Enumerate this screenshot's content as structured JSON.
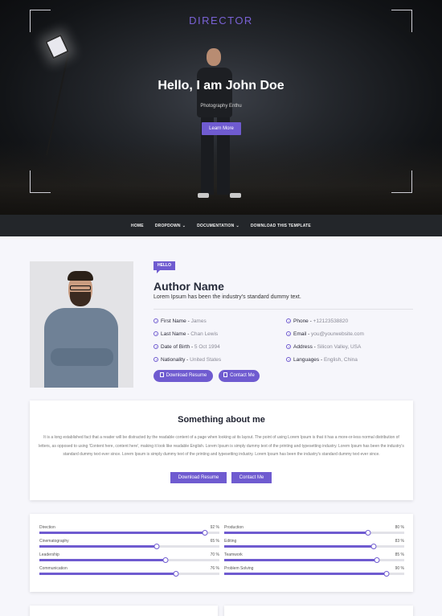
{
  "hero": {
    "brand": "DIRECTOR",
    "title": "Hello, I am John Doe",
    "subtitle": "Photography Enthu",
    "button": "Learn More"
  },
  "nav": {
    "items": [
      {
        "label": "HOME",
        "dropdown": false
      },
      {
        "label": "DROPDOWN",
        "dropdown": true
      },
      {
        "label": "DOCUMENTATION",
        "dropdown": true
      },
      {
        "label": "DOWNLOAD THIS TEMPLATE",
        "dropdown": false
      }
    ]
  },
  "profile": {
    "badge": "HELLO",
    "name": "Author Name",
    "tagline": "Lorem Ipsum has been the industry's standard dummy text.",
    "left_info": [
      {
        "label": "First Name",
        "value": "James"
      },
      {
        "label": "Last Name",
        "value": "Chan Lewis"
      },
      {
        "label": "Date of Birth",
        "value": "5 Oct 1994"
      },
      {
        "label": "Nationality",
        "value": "United States"
      }
    ],
    "right_info": [
      {
        "label": "Phone",
        "value": "+12123538820"
      },
      {
        "label": "Email",
        "value": "you@yourwebsite.com"
      },
      {
        "label": "Address",
        "value": "Silicon Valley, USA"
      },
      {
        "label": "Languages",
        "value": "English, China"
      }
    ],
    "download_button": "Download Resume",
    "contact_button": "Contact Me"
  },
  "about": {
    "title": "Something about me",
    "text": "It is a long established fact that a reader will be distracted by the readable content of a page when looking at its layout. The point of using Lorem Ipsum is that it has a more-or-less normal distribution of letters, as opposed to using 'Content here, content here', making it look like readable English. Lorem Ipsum is simply dummy text of the printing and typesetting industry. Lorem Ipsum has been the industry's standard dummy text ever since. Lorem Ipsum is simply dummy text of the printing and typesetting industry. Lorem Ipsum has been the industry's standard dummy text ever since.",
    "download_button": "Download Resume",
    "contact_button": "Contact Me"
  },
  "skills": {
    "left": [
      {
        "name": "Direction",
        "percent": 92,
        "label": "92 %"
      },
      {
        "name": "Cinematography",
        "percent": 65,
        "label": "65 %"
      },
      {
        "name": "Leadership",
        "percent": 70,
        "label": "70 %"
      },
      {
        "name": "Communication",
        "percent": 76,
        "label": "76 %"
      }
    ],
    "right": [
      {
        "name": "Production",
        "percent": 80,
        "label": "80 %"
      },
      {
        "name": "Editing",
        "percent": 83,
        "label": "83 %"
      },
      {
        "name": "Teamwork",
        "percent": 85,
        "label": "85 %"
      },
      {
        "name": "Problem Solving",
        "percent": 90,
        "label": "90 %"
      }
    ]
  },
  "colors": {
    "accent": "#6f5bd0",
    "nav_bg": "#23262a"
  }
}
